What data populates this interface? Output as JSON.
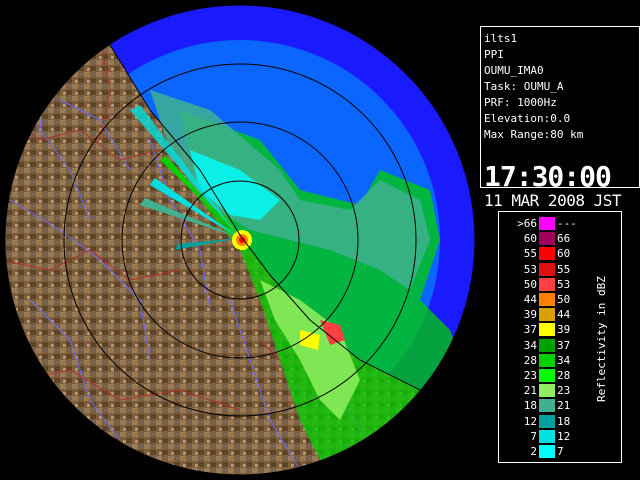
{
  "info": {
    "site": "ilts1",
    "scan_type": "PPI",
    "product": "OUMU_IMA0",
    "task": "Task: OUMU_A",
    "prf": "PRF: 1000Hz",
    "elevation": "Elevation:0.0",
    "max_range": "Max Range:80 km",
    "time": "17:30:00",
    "date": "11 MAR 2008 JST"
  },
  "legend": {
    "title": "Reflectivity in dBZ",
    "rows": [
      {
        "low": ">66",
        "high": "---",
        "color": "#ff00ff"
      },
      {
        "low": "60",
        "high": "66",
        "color": "#a0005a"
      },
      {
        "low": "55",
        "high": "60",
        "color": "#ff0000"
      },
      {
        "low": "53",
        "high": "55",
        "color": "#dd1010"
      },
      {
        "low": "50",
        "high": "53",
        "color": "#ff4040"
      },
      {
        "low": "44",
        "high": "50",
        "color": "#ff8000"
      },
      {
        "low": "39",
        "high": "44",
        "color": "#d8a000"
      },
      {
        "low": "37",
        "high": "39",
        "color": "#ffff00"
      },
      {
        "low": "34",
        "high": "37",
        "color": "#00a000"
      },
      {
        "low": "28",
        "high": "34",
        "color": "#00d000"
      },
      {
        "low": "23",
        "high": "28",
        "color": "#00ff00"
      },
      {
        "low": "21",
        "high": "23",
        "color": "#90ee60"
      },
      {
        "low": "18",
        "high": "21",
        "color": "#40b090"
      },
      {
        "low": "12",
        "high": "18",
        "color": "#00a0a0"
      },
      {
        "low": "7",
        "high": "12",
        "color": "#00e0e0"
      },
      {
        "low": "2",
        "high": "7",
        "color": "#00ffff"
      }
    ]
  },
  "colors": {
    "ocean": "#0a66ff",
    "outer_ocean": "#1a1aff",
    "land": "#7a5c3a",
    "rivers": "#6c6cff",
    "borders": "#b03030",
    "range_rings": "#000000"
  }
}
